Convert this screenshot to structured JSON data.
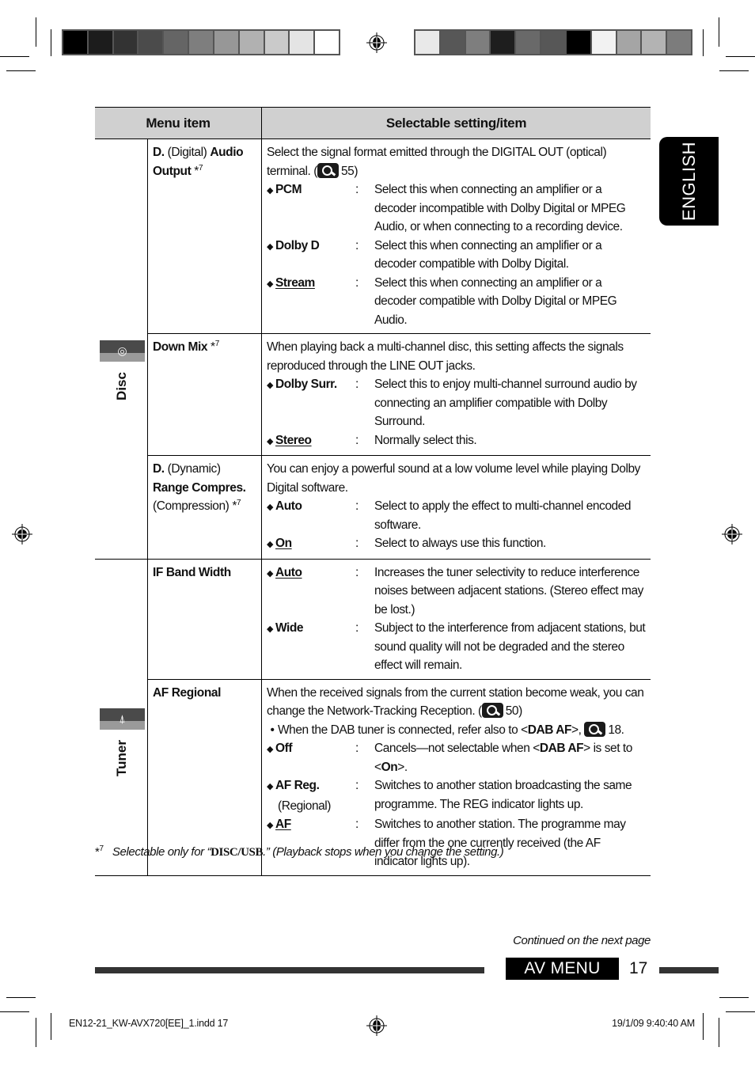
{
  "print_marks": {
    "left_color_bar": [
      "#000000",
      "#1c1c1c",
      "#333333",
      "#4b4b4b",
      "#656565",
      "#7e7e7e",
      "#979797",
      "#b1b1b1",
      "#cacaca",
      "#e4e4e4",
      "#ffffff"
    ],
    "right_color_bar": [
      "#e9e9e9",
      "#575757",
      "#7e7e7e",
      "#1e1e1e",
      "#696969",
      "#575757",
      "#000000",
      "#f2f2f2",
      "#a5a5a5",
      "#b3b3b3",
      "#7c7c7c"
    ],
    "slug_left": "EN12-21_KW-AVX720[EE]_1.indd   17",
    "slug_right": "19/1/09   9:40:40 AM"
  },
  "side_tab": {
    "label": "ENGLISH"
  },
  "table": {
    "headers": {
      "menu_item": "Menu item",
      "selectable": "Selectable setting/item"
    },
    "groups": [
      {
        "category": "Disc",
        "icon": "disc-icon",
        "rows": [
          {
            "menu": {
              "parts": [
                {
                  "t": "D.",
                  "b": true
                },
                {
                  "t": " (Digital) ",
                  "b": false
                },
                {
                  "t": "Audio Output",
                  "b": true
                },
                {
                  "t": " *",
                  "b": false
                }
              ],
              "sup": "7"
            },
            "intro": "Select the signal format emitted through the DIGITAL OUT (optical) terminal.",
            "ref": {
              "pre": "(",
              "page": "55",
              "post": ")"
            },
            "options": [
              {
                "name": "PCM",
                "default": false,
                "desc": "Select this when connecting an amplifier or a decoder incompatible with Dolby Digital or MPEG Audio, or when connecting to a recording device."
              },
              {
                "name": "Dolby D",
                "default": false,
                "desc": "Select this when connecting an amplifier or a decoder compatible with Dolby Digital."
              },
              {
                "name": "Stream",
                "default": true,
                "desc": "Select this when connecting an amplifier or a decoder compatible with Dolby Digital or MPEG Audio."
              }
            ]
          },
          {
            "menu": {
              "parts": [
                {
                  "t": "Down Mix",
                  "b": true
                },
                {
                  "t": " *",
                  "b": false
                }
              ],
              "sup": "7"
            },
            "intro": "When playing back a multi-channel disc, this setting affects the signals reproduced through the LINE OUT jacks.",
            "options": [
              {
                "name": "Dolby Surr.",
                "default": false,
                "desc": "Select this to enjoy multi-channel surround audio by connecting an amplifier compatible with Dolby Surround."
              },
              {
                "name": "Stereo",
                "default": true,
                "desc": "Normally select this."
              }
            ]
          },
          {
            "menu": {
              "parts": [
                {
                  "t": "D.",
                  "b": true
                },
                {
                  "t": " (Dynamic)",
                  "b": false
                },
                {
                  "br": true
                },
                {
                  "t": "Range Compres.",
                  "b": true
                },
                {
                  "br": true
                },
                {
                  "t": "(Compression) *",
                  "b": false
                }
              ],
              "sup": "7"
            },
            "intro": "You can enjoy a powerful sound at a low volume level while playing Dolby Digital software.",
            "options": [
              {
                "name": "Auto",
                "default": false,
                "desc": "Select to apply the effect to multi-channel encoded software."
              },
              {
                "name": "On",
                "default": true,
                "desc": "Select to always use this function."
              }
            ]
          }
        ]
      },
      {
        "category": "Tuner",
        "icon": "tuner-antenna-icon",
        "rows": [
          {
            "menu": {
              "parts": [
                {
                  "t": "IF Band Width",
                  "b": true
                }
              ]
            },
            "options": [
              {
                "name": "Auto",
                "default": true,
                "desc": "Increases the tuner selectivity to reduce interference noises between adjacent stations. (Stereo effect may be lost.)"
              },
              {
                "name": "Wide",
                "default": false,
                "desc": "Subject to the interference from adjacent stations, but sound quality will not be degraded and the stereo effect will remain."
              }
            ]
          },
          {
            "menu": {
              "parts": [
                {
                  "t": "AF Regional",
                  "b": true
                }
              ]
            },
            "intro": "When the received signals from the current station become weak, you can change the Network-Tracking Reception.",
            "ref": {
              "pre": "(",
              "page": "50",
              "post": ")"
            },
            "bullet": {
              "pre": "When the DAB tuner is connected, refer also to <",
              "bold": "DAB AF",
              "post": ">, ",
              "page": "18."
            },
            "options": [
              {
                "name": "Off",
                "default": false,
                "desc_rich": [
                  {
                    "t": "Cancels—not selectable when <"
                  },
                  {
                    "t": "DAB AF",
                    "b": true
                  },
                  {
                    "t": "> is set to <"
                  },
                  {
                    "t": "On",
                    "b": true
                  },
                  {
                    "t": ">."
                  }
                ]
              },
              {
                "name": "AF Reg.",
                "sub": "(Regional)",
                "default": false,
                "desc": "Switches to another station broadcasting the same programme. The REG indicator lights up."
              },
              {
                "name": "AF",
                "default": true,
                "desc": "Switches to another station. The programme may differ from the one currently received (the AF indicator lights up)."
              }
            ]
          }
        ]
      }
    ]
  },
  "footnote": {
    "mark": "*",
    "num": "7",
    "pre": "Selectable only for “",
    "bold": "DISC/USB",
    "post": ".” (Playback stops when you change the setting.)"
  },
  "continued": "Continued on the next page",
  "section_label": "AV MENU",
  "page_number": "17"
}
